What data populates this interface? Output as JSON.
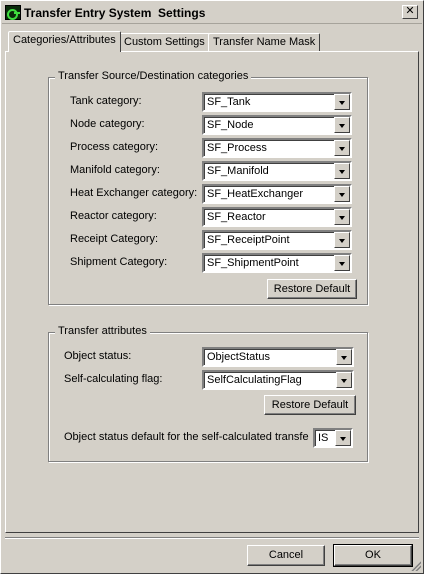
{
  "window": {
    "title": "Transfer Entry System  Settings",
    "close_glyph": "✕"
  },
  "tabs": [
    {
      "label": "Categories/Attributes",
      "active": true
    },
    {
      "label": "Custom Settings",
      "active": false
    },
    {
      "label": "Transfer Name Mask",
      "active": false
    }
  ],
  "source_dest": {
    "legend": "Transfer Source/Destination categories",
    "rows": [
      {
        "label": "Tank category:",
        "value": "SF_Tank"
      },
      {
        "label": "Node category:",
        "value": "SF_Node"
      },
      {
        "label": "Process category:",
        "value": "SF_Process"
      },
      {
        "label": "Manifold category:",
        "value": "SF_Manifold"
      },
      {
        "label": "Heat Exchanger category:",
        "value": "SF_HeatExchanger"
      },
      {
        "label": "Reactor category:",
        "value": "SF_Reactor"
      },
      {
        "label": "Receipt Category:",
        "value": "SF_ReceiptPoint"
      },
      {
        "label": "Shipment Category:",
        "value": "SF_ShipmentPoint"
      }
    ],
    "restore_label": "Restore Default"
  },
  "attributes": {
    "legend": "Transfer attributes",
    "rows": [
      {
        "label": "Object status:",
        "value": "ObjectStatus"
      },
      {
        "label": "Self-calculating flag:",
        "value": "SelfCalculatingFlag"
      }
    ],
    "restore_label": "Restore Default",
    "default_status_label": "Object status default for the self-calculated transfe",
    "default_status_value": "IS"
  },
  "footer": {
    "cancel_label": "Cancel",
    "ok_label": "OK"
  },
  "icons": {
    "app": "app-icon",
    "close": "close-icon",
    "dropdown": "chevron-down-icon",
    "grip": "resize-grip-icon"
  }
}
